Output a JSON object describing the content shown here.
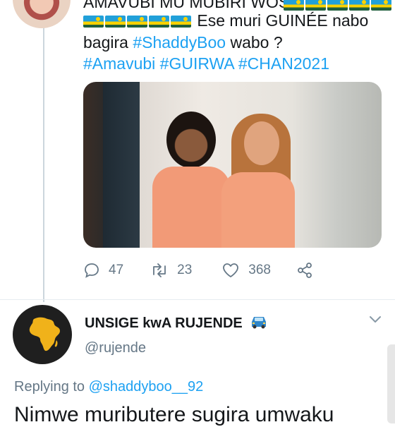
{
  "tweet": {
    "line1": "AMAVUBI MU MUBIRI WOSE !",
    "line2_text": "Ese muri GUINÉE nabo",
    "line3_pre": "bagira ",
    "line3_tag": "#ShaddyBoo",
    "line3_post": " wabo ?",
    "line4": "#Amavubi #GUIRWA #CHAN2021",
    "flag_emoji": "rwanda-flag",
    "actions": {
      "replies": "47",
      "retweets": "23",
      "likes": "368"
    }
  },
  "reply": {
    "name": "UNSIGE kwA RUJENDE",
    "name_emoji": "car-icon",
    "handle": "@rujende",
    "replying_label": "Replying to",
    "replying_to": "@shaddyboo__92",
    "text": "Nimwe muributere sugira umwaku"
  },
  "colors": {
    "link": "#1da1f2",
    "muted": "#657786",
    "text": "#14171a"
  }
}
